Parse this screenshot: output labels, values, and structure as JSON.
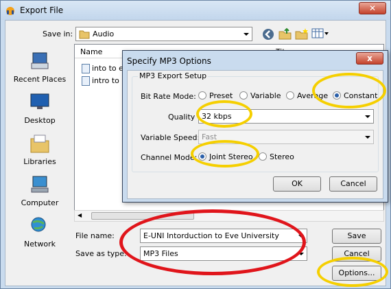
{
  "window": {
    "title": "Export File"
  },
  "save_in": {
    "label": "Save in:",
    "value": "Audio"
  },
  "places": [
    {
      "label": "Recent Places",
      "icon": "recent-places-icon"
    },
    {
      "label": "Desktop",
      "icon": "desktop-icon"
    },
    {
      "label": "Libraries",
      "icon": "libraries-icon"
    },
    {
      "label": "Computer",
      "icon": "computer-icon"
    },
    {
      "label": "Network",
      "icon": "network-icon"
    }
  ],
  "file_list": {
    "column_name": "Name",
    "column_title": "Tit",
    "items": [
      "into to e",
      "intro to e"
    ]
  },
  "filename": {
    "label": "File name:",
    "value": "E-UNI Intorduction to Eve University"
  },
  "savetype": {
    "label": "Save as type:",
    "value": "MP3 Files"
  },
  "buttons": {
    "save": "Save",
    "cancel": "Cancel",
    "options": "Options..."
  },
  "mp3_dialog": {
    "title": "Specify MP3 Options",
    "close": "x",
    "group": "MP3 Export Setup",
    "bit_rate_mode": {
      "label": "Bit Rate Mode:",
      "options": [
        "Preset",
        "Variable",
        "Average",
        "Constant"
      ],
      "selected": "Constant"
    },
    "quality": {
      "label": "Quality",
      "value": "32 kbps"
    },
    "variable_speed": {
      "label": "Variable Speed:",
      "value": "Fast"
    },
    "channel_mode": {
      "label": "Channel Mode:",
      "options": [
        "Joint Stereo",
        "Stereo"
      ],
      "selected": "Joint Stereo"
    },
    "ok": "OK",
    "cancel": "Cancel"
  },
  "colors": {
    "highlight_yellow": "#f5cf00",
    "highlight_red": "#e0151b"
  }
}
